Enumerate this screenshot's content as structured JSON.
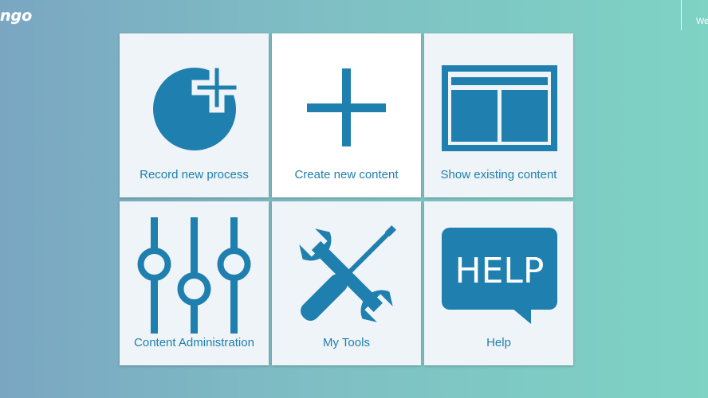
{
  "header": {
    "logo_text": "ngo",
    "user_text": "We"
  },
  "tiles": [
    {
      "label": "Record new process",
      "icon": "record-plus-icon"
    },
    {
      "label": "Create new content",
      "icon": "plus-icon"
    },
    {
      "label": "Show existing content",
      "icon": "layout-window-icon"
    },
    {
      "label": "Content Administration",
      "icon": "sliders-icon"
    },
    {
      "label": "My Tools",
      "icon": "tools-icon"
    },
    {
      "label": "Help",
      "icon": "help-bubble-icon",
      "icon_text": "HELP"
    }
  ],
  "colors": {
    "accent": "#1f7fae",
    "tile_bg": "#eef4f7",
    "tile_active_bg": "#ffffff"
  }
}
